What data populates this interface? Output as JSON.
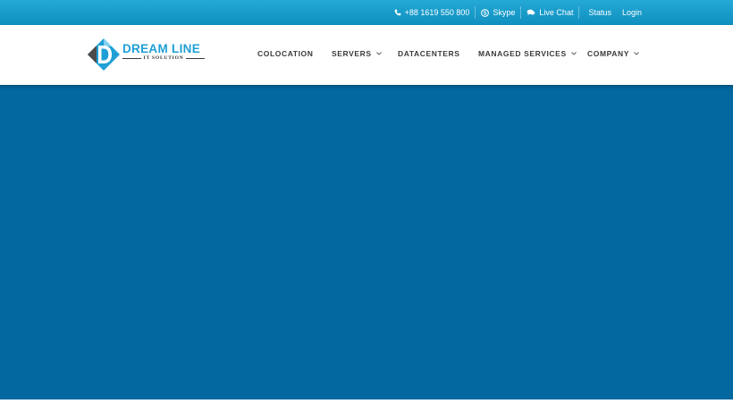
{
  "topbar": {
    "phone": {
      "icon": "phone-icon",
      "label": "+88 1619 550 800"
    },
    "skype": {
      "icon": "skype-icon",
      "label": "Skype"
    },
    "livechat": {
      "icon": "chat-icon",
      "label": "Live Chat"
    },
    "status": {
      "label": "Status"
    },
    "login": {
      "label": "Login"
    }
  },
  "logo": {
    "title": "DREAM LINE",
    "subtitle": "IT SOLUTION"
  },
  "nav": {
    "items": [
      {
        "label": "COLOCATION",
        "has_dropdown": false
      },
      {
        "label": "SERVERS",
        "has_dropdown": true
      },
      {
        "label": "DATACENTERS",
        "has_dropdown": false
      },
      {
        "label": "MANAGED SERVICES",
        "has_dropdown": true
      },
      {
        "label": "COMPANY",
        "has_dropdown": true
      }
    ]
  },
  "colors": {
    "topbar": "#1a9cca",
    "hero": "#02689f",
    "brand": "#1e9fd6"
  }
}
